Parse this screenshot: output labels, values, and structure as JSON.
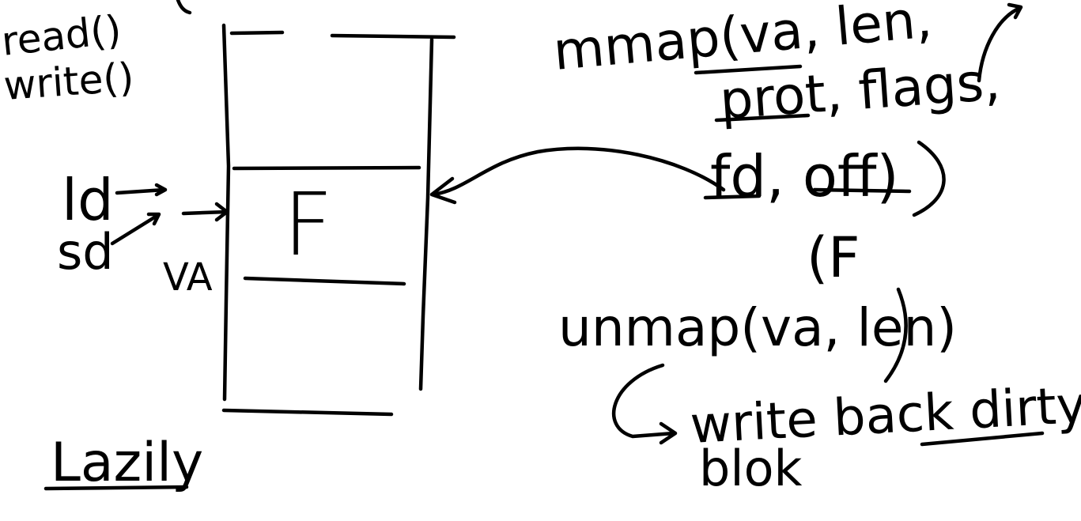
{
  "ink_color": "#000000",
  "background_color": "#ffffff",
  "labels": {
    "read_call": "read()",
    "write_call": "write()",
    "ld": "ld",
    "sd": "sd",
    "va": "VA",
    "lazily": "Lazily",
    "region_label": "F",
    "mmap_line1": "mmap(va, len,",
    "mmap_line2": "prot, flags,",
    "mmap_line3": "fd, off)",
    "file_hint": "(F",
    "unmap_call": "unmap(va, len)",
    "write_back": "write back dirty",
    "block": "blok"
  }
}
